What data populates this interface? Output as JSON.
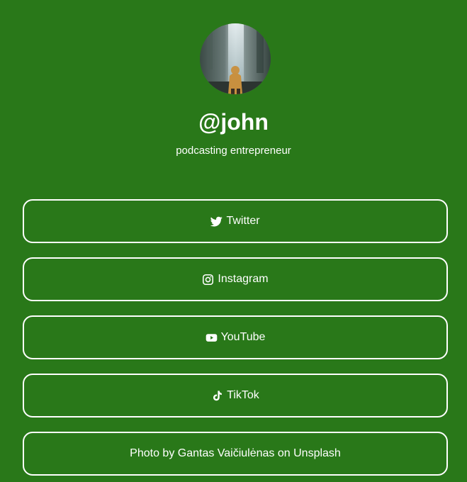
{
  "profile": {
    "handle": "@john",
    "bio": "podcasting entrepreneur"
  },
  "links": [
    {
      "label": "Twitter",
      "icon": "twitter-icon"
    },
    {
      "label": "Instagram",
      "icon": "instagram-icon"
    },
    {
      "label": "YouTube",
      "icon": "youtube-icon"
    },
    {
      "label": "TikTok",
      "icon": "tiktok-icon"
    },
    {
      "label": "Photo by Gantas Vaičiulėnas on Unsplash"
    }
  ],
  "colors": {
    "background": "#297819",
    "foreground": "#ffffff"
  }
}
